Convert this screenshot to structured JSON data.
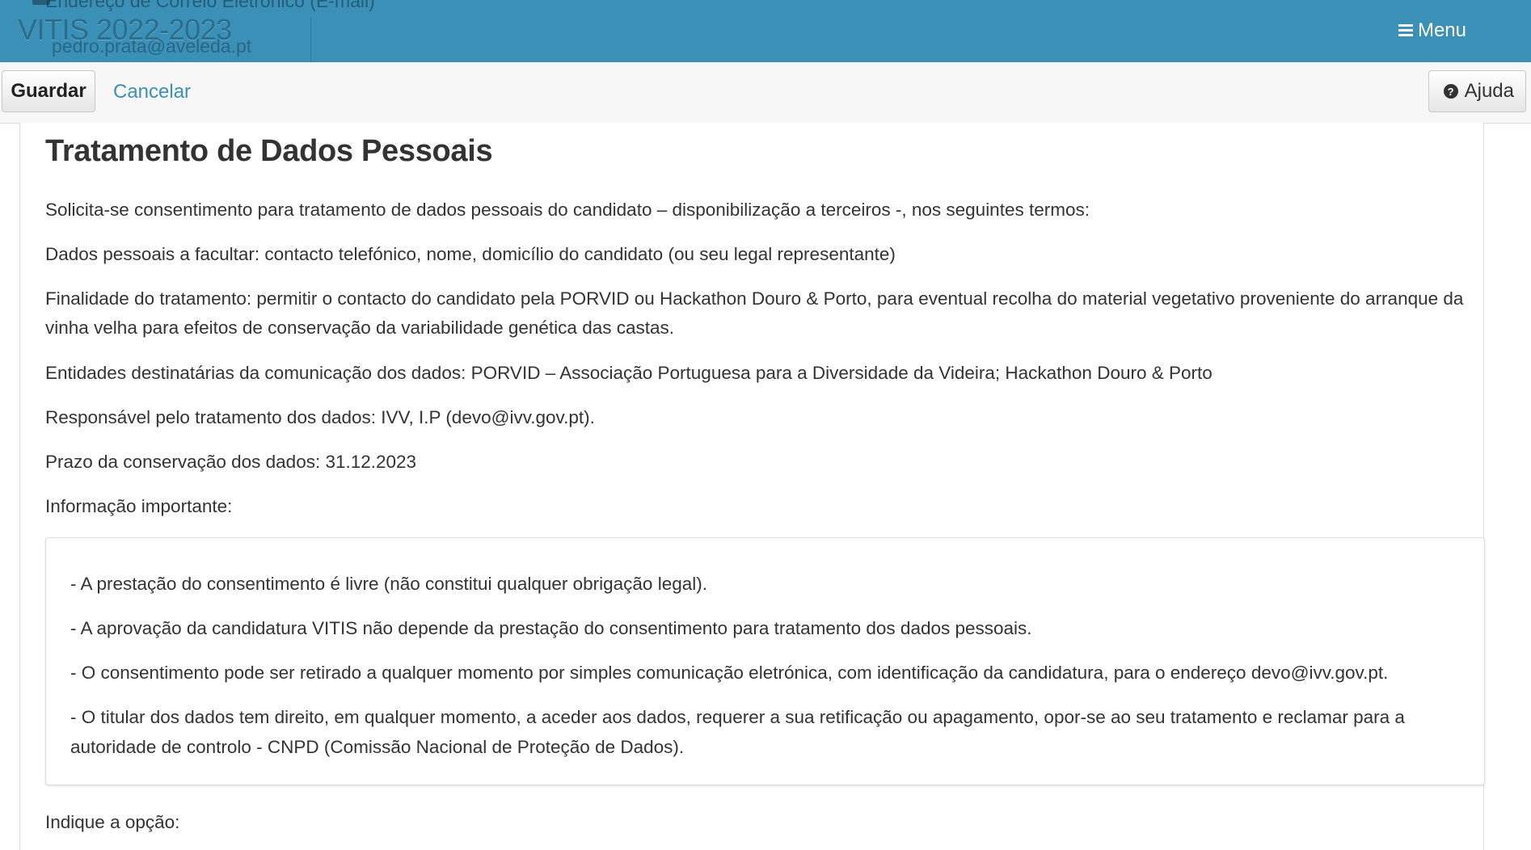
{
  "header": {
    "title": "VITIS 2022-2023",
    "menu_label": "Menu",
    "background_label": "Endereço de Correio Eletrónico (E-mail)",
    "background_email": "pedro.prata@aveleda.pt"
  },
  "toolbar": {
    "save_label": "Guardar",
    "cancel_label": "Cancelar",
    "help_label": "Ajuda"
  },
  "content": {
    "title": "Tratamento de Dados Pessoais",
    "paragraphs": [
      "Solicita-se consentimento para tratamento de dados pessoais do candidato – disponibilização a terceiros -, nos seguintes termos:",
      "Dados pessoais a facultar: contacto telefónico, nome, domicílio do candidato (ou seu legal representante)",
      "Finalidade do tratamento: permitir o contacto do candidato pela PORVID ou Hackathon Douro & Porto, para eventual recolha do material vegetativo proveniente do arranque da vinha velha para efeitos de conservação da variabilidade genética das castas.",
      "Entidades destinatárias da comunicação dos dados: PORVID – Associação Portuguesa para a Diversidade da Videira; Hackathon Douro & Porto",
      "Responsável pelo tratamento dos dados: IVV, I.P (devo@ivv.gov.pt).",
      "Prazo da conservação dos dados: 31.12.2023",
      "Informação importante:"
    ],
    "important_info": [
      "- A prestação do consentimento é livre (não constitui qualquer obrigação legal).",
      "- A aprovação da candidatura VITIS não depende da prestação do consentimento para tratamento dos dados pessoais.",
      "- O consentimento pode ser retirado a qualquer momento por simples comunicação eletrónica, com identificação da candidatura, para o endereço devo@ivv.gov.pt.",
      "- O titular dos dados tem direito, em qualquer momento, a aceder aos dados, requerer a sua retificação ou apagamento, opor-se ao seu tratamento e reclamar para a autoridade de controlo - CNPD (Comissão Nacional de Proteção de Dados)."
    ],
    "option_prompt": "Indique a opção:"
  },
  "icons": {
    "menu": "list-icon",
    "help": "question-circle-icon"
  },
  "colors": {
    "header_bg": "#3a90b6",
    "link": "#3a90b6",
    "toolbar_bg": "#f7f7f7"
  }
}
